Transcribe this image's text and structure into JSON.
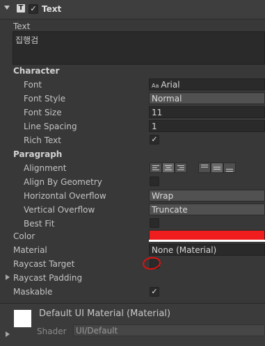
{
  "component": {
    "title": "Text",
    "icon": "text-component-icon",
    "enabled": true
  },
  "text": {
    "label": "Text",
    "value": "집행검"
  },
  "character": {
    "header": "Character",
    "font": {
      "label": "Font",
      "value": "Arial",
      "icon_text": "Aa"
    },
    "font_style": {
      "label": "Font Style",
      "value": "Normal"
    },
    "font_size": {
      "label": "Font Size",
      "value": "11"
    },
    "line_spacing": {
      "label": "Line Spacing",
      "value": "1"
    },
    "rich_text": {
      "label": "Rich Text",
      "checked": true
    }
  },
  "paragraph": {
    "header": "Paragraph",
    "alignment": {
      "label": "Alignment"
    },
    "align_by_geometry": {
      "label": "Align By Geometry",
      "checked": false
    },
    "horizontal_overflow": {
      "label": "Horizontal Overflow",
      "value": "Wrap"
    },
    "vertical_overflow": {
      "label": "Vertical Overflow",
      "value": "Truncate"
    },
    "best_fit": {
      "label": "Best Fit",
      "checked": false
    }
  },
  "color": {
    "label": "Color",
    "value": "#ef1d1d"
  },
  "material": {
    "label": "Material",
    "value": "None (Material)"
  },
  "raycast_target": {
    "label": "Raycast Target",
    "checked": false
  },
  "raycast_padding": {
    "label": "Raycast Padding"
  },
  "maskable": {
    "label": "Maskable",
    "checked": true
  },
  "material_preview": {
    "title": "Default UI Material (Material)",
    "shader_label": "Shader",
    "shader_value": "UI/Default"
  },
  "check_glyph": "✓"
}
